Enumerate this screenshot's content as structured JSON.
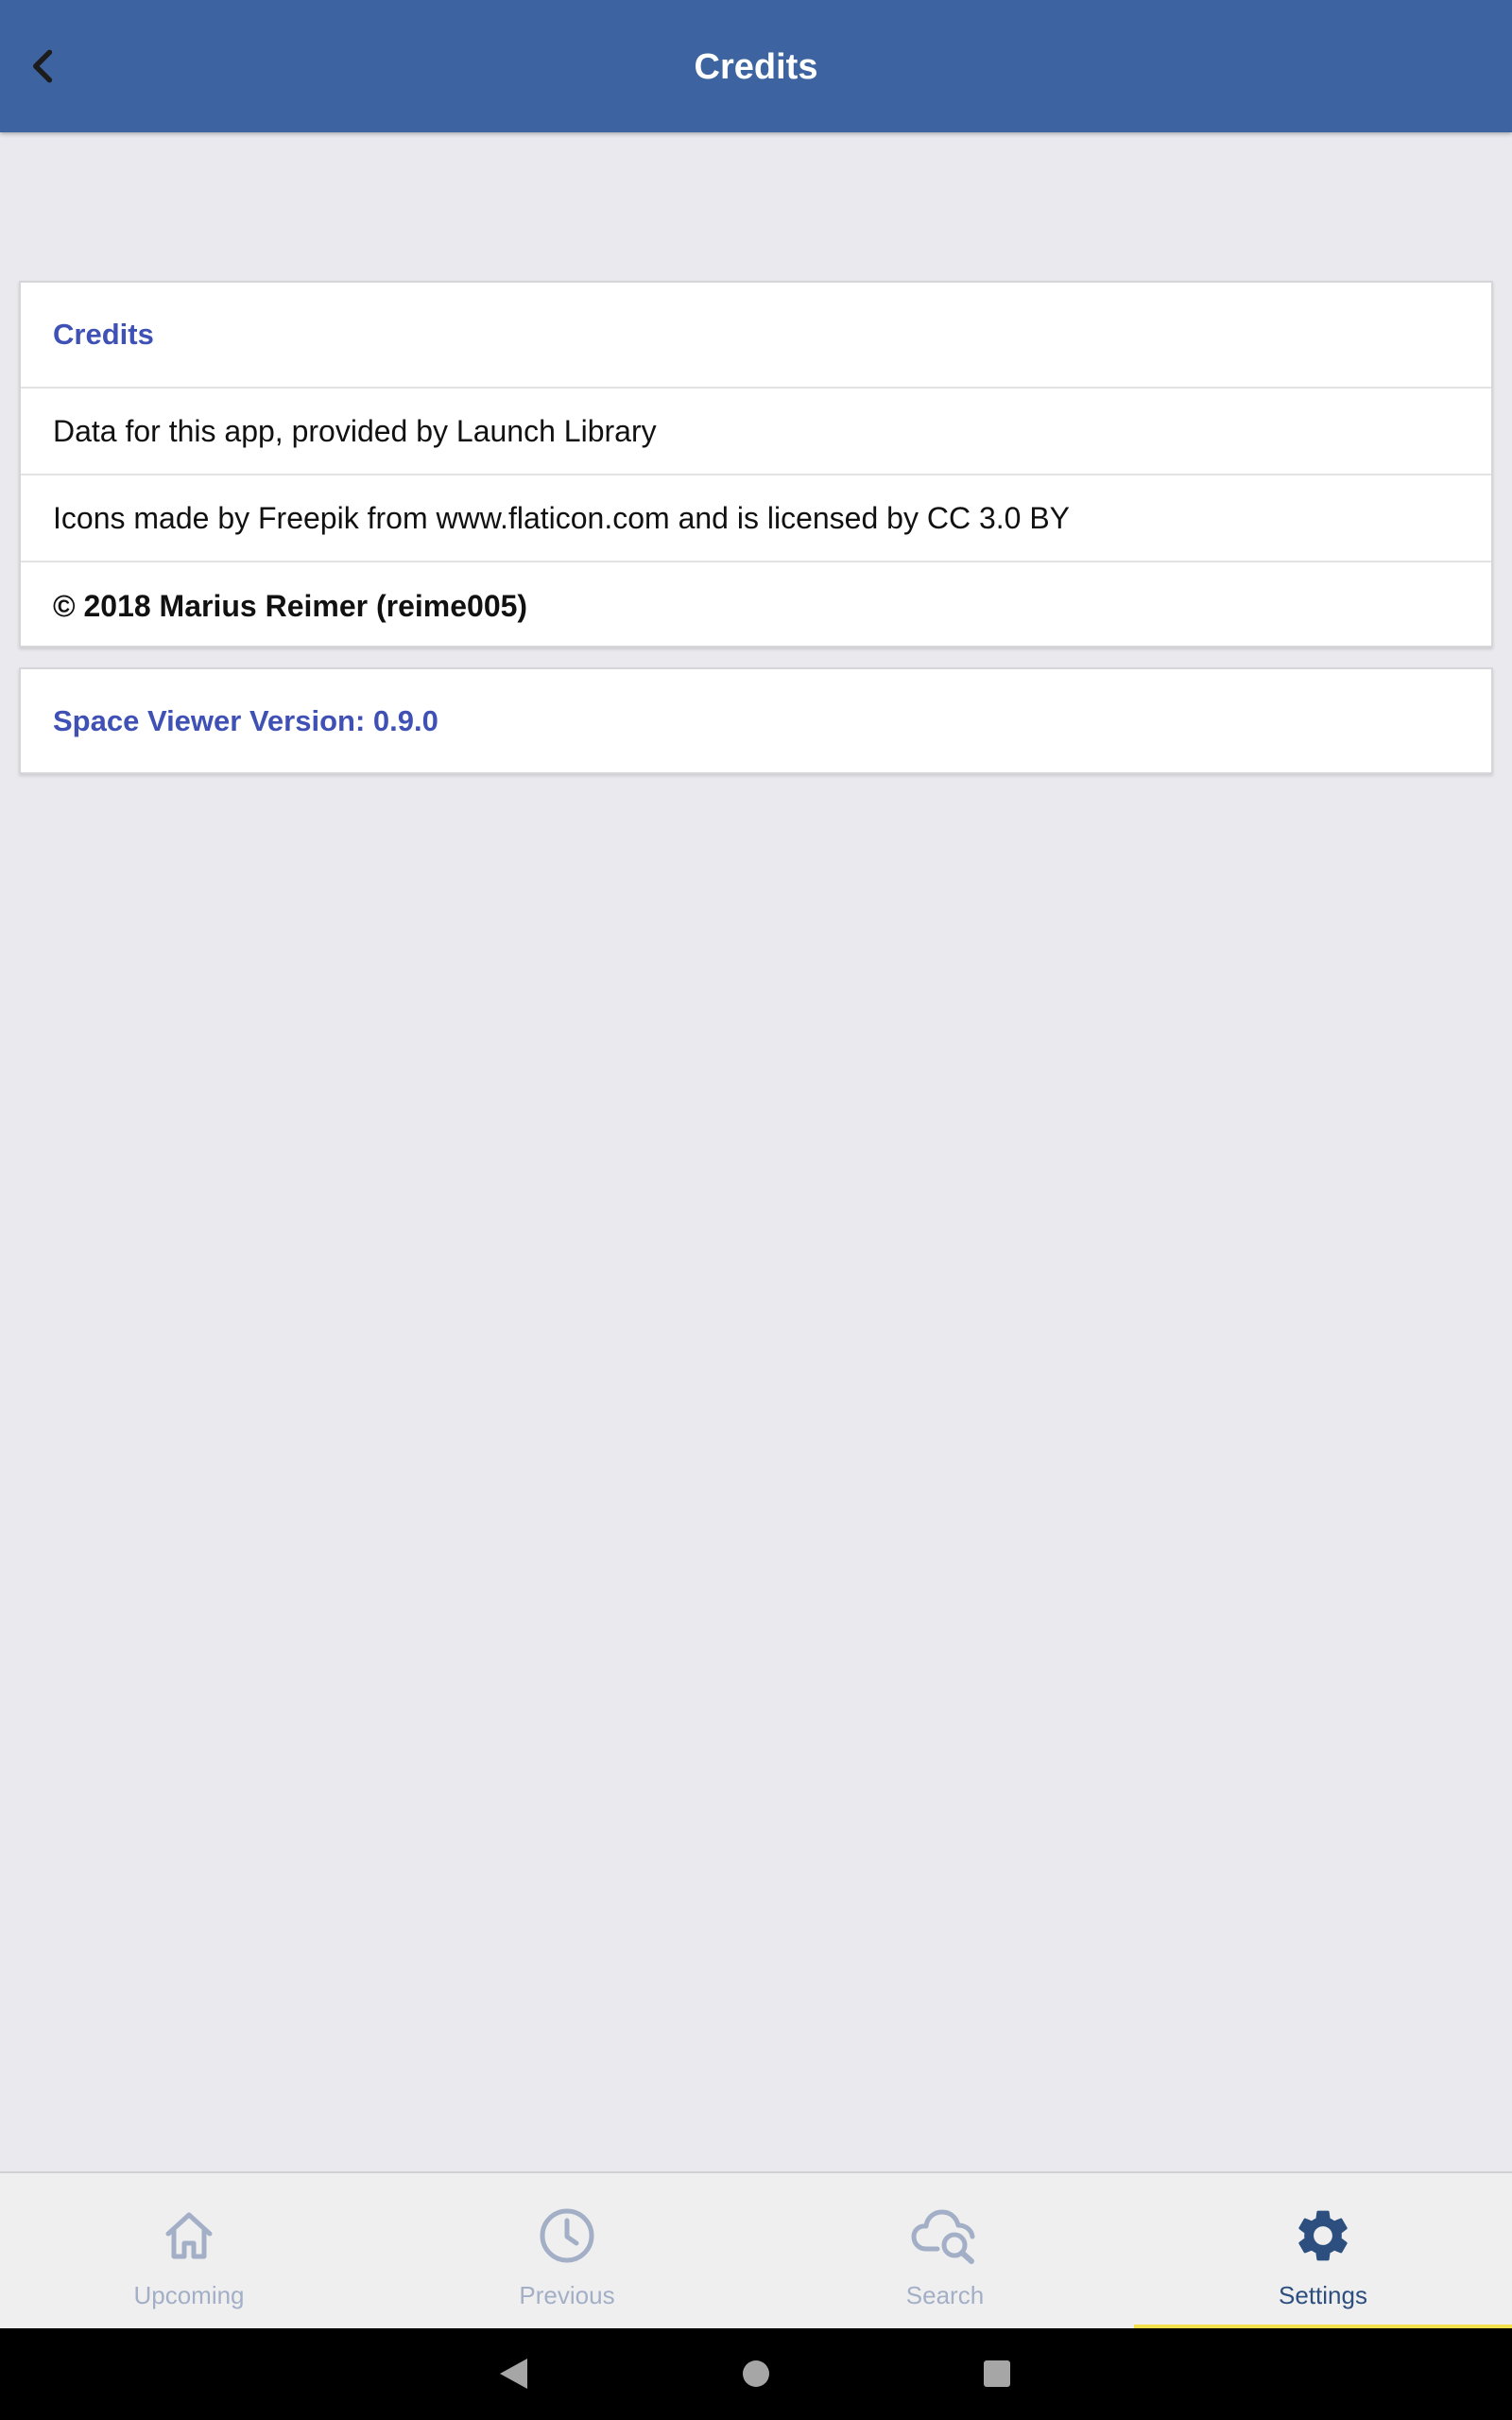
{
  "appbar": {
    "title": "Credits",
    "back_icon": "chevron-left-icon"
  },
  "credits_card": {
    "header": "Credits",
    "items": [
      "Data for this app, provided by Launch Library",
      "Icons made by Freepik from www.flaticon.com and is licensed by CC 3.0 BY",
      "© 2018 Marius Reimer (reime005)"
    ]
  },
  "version_card": {
    "label": "Space Viewer Version: 0.9.0"
  },
  "bottom_nav": {
    "items": [
      {
        "label": "Upcoming",
        "icon": "home-icon",
        "active": false
      },
      {
        "label": "Previous",
        "icon": "clock-icon",
        "active": false
      },
      {
        "label": "Search",
        "icon": "cloud-search-icon",
        "active": false
      },
      {
        "label": "Settings",
        "icon": "gear-icon",
        "active": true
      }
    ]
  },
  "colors": {
    "appbar": "#3d64a0",
    "accent_header": "#3f51b5",
    "nav_inactive": "#a3afc6",
    "nav_active": "#2d4f80",
    "nav_indicator": "#f2e14a",
    "background": "#e9e9ee"
  }
}
